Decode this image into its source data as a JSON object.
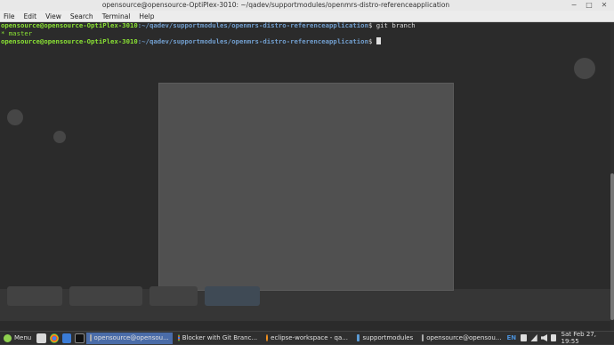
{
  "window": {
    "title": "opensource@opensource-OptiPlex-3010: ~/qadev/supportmodules/openmrs-distro-referenceapplication",
    "controls": [
      "minimize-icon",
      "maximize-icon",
      "close-icon"
    ]
  },
  "menubar": {
    "items": [
      "File",
      "Edit",
      "View",
      "Search",
      "Terminal",
      "Help"
    ]
  },
  "terminal": {
    "line1": {
      "user_host": "opensource@opensource-OptiPlex-3010",
      "path": ":~/qadev/supportmodules/openmrs-distro-referenceapplication",
      "command": "$ git branch"
    },
    "line2": "* master",
    "line3": {
      "user_host": "opensource@opensource-OptiPlex-3010",
      "path": ":~/qadev/supportmodules/openmrs-distro-referenceapplication",
      "command": "$ "
    }
  },
  "taskbar": {
    "menu_label": "Menu",
    "tasks": [
      {
        "label": "opensource@opensou...",
        "icon": "terminal-icon",
        "active": true
      },
      {
        "label": "Blocker with Git Branc...",
        "icon": "chrome-icon",
        "active": false
      },
      {
        "label": "eclipse-workspace - qa...",
        "icon": "eclipse-icon",
        "active": false
      },
      {
        "label": "supportmodules",
        "icon": "folder-icon",
        "active": false
      },
      {
        "label": "opensource@opensou...",
        "icon": "terminal-icon",
        "active": false
      }
    ],
    "tray": {
      "language": "EN",
      "clock": "Sat Feb 27, 19:55"
    },
    "colors": {
      "accent": "#4a6ca8",
      "mint": "#8fd14f"
    }
  }
}
